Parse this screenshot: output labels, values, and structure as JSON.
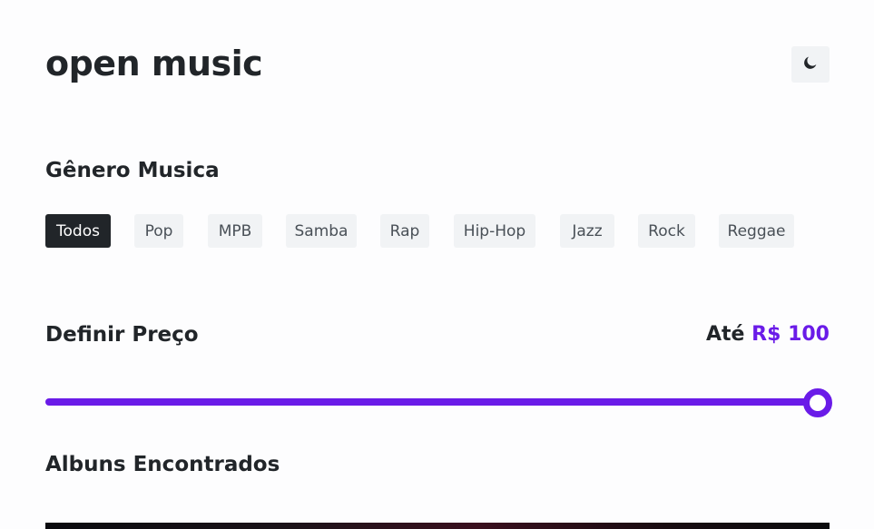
{
  "header": {
    "app_title": "open music",
    "theme_toggle_icon": "moon-icon"
  },
  "genre": {
    "title": "Gênero Musica",
    "chips": [
      {
        "label": "Todos",
        "active": true
      },
      {
        "label": "Pop",
        "active": false
      },
      {
        "label": "MPB",
        "active": false
      },
      {
        "label": "Samba",
        "active": false
      },
      {
        "label": "Rap",
        "active": false
      },
      {
        "label": "Hip-Hop",
        "active": false
      },
      {
        "label": "Jazz",
        "active": false
      },
      {
        "label": "Rock",
        "active": false
      },
      {
        "label": "Reggae",
        "active": false
      }
    ]
  },
  "price": {
    "title": "Definir Preço",
    "prefix": "Até",
    "value_text": "R$ 100",
    "slider_level": 1.0
  },
  "albums": {
    "title": "Albuns Encontrados"
  },
  "colors": {
    "accent": "#6a1be8",
    "text": "#212529",
    "chip_bg": "#f1f3f5",
    "chip_active_bg": "#212529"
  }
}
